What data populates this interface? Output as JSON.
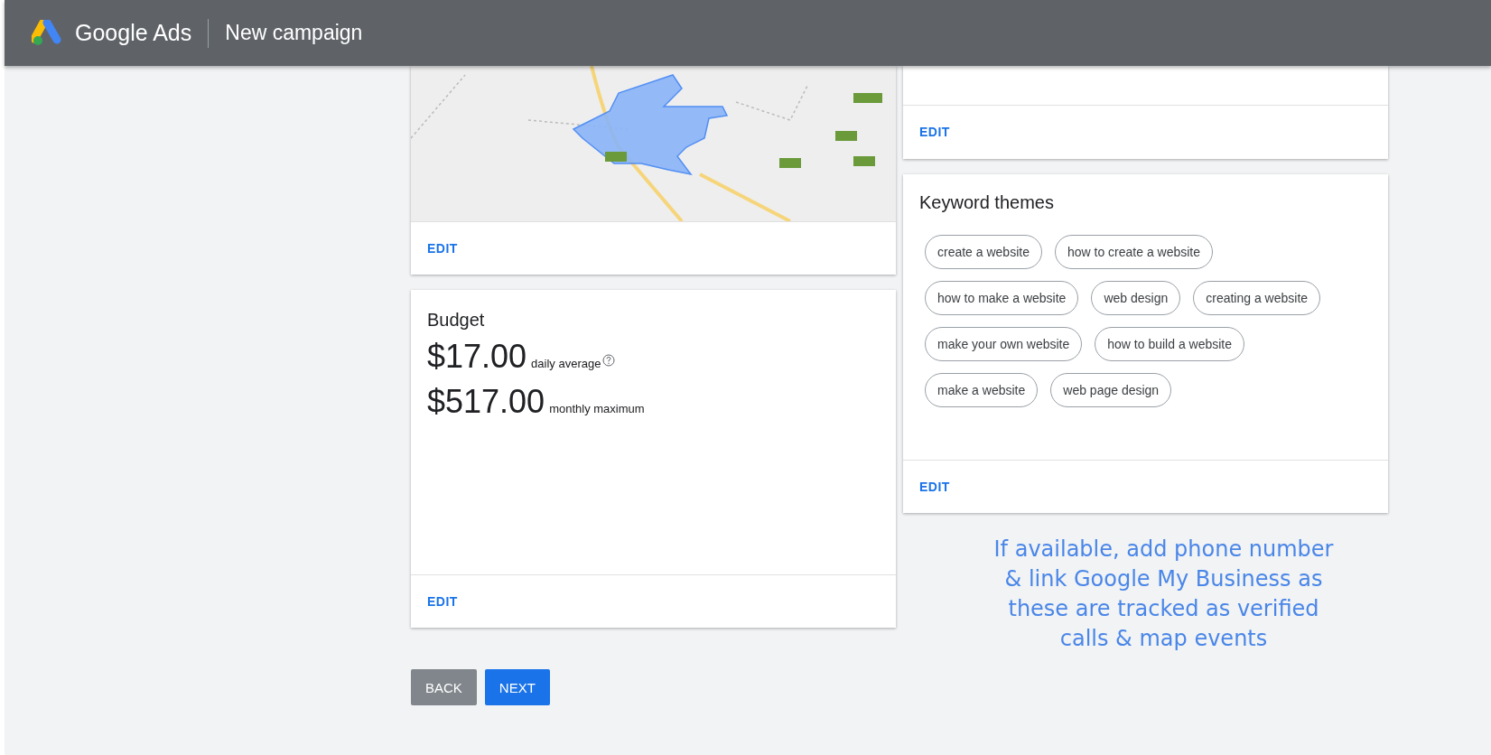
{
  "header": {
    "product": "Google Ads",
    "page_title": "New campaign"
  },
  "location_card": {
    "edit": "EDIT"
  },
  "top_right_card": {
    "edit": "EDIT"
  },
  "budget_card": {
    "title": "Budget",
    "lines": [
      {
        "amount": "$17.00",
        "caption": "daily average",
        "help": true
      },
      {
        "amount": "$517.00",
        "caption": "monthly maximum",
        "help": false
      }
    ],
    "edit": "EDIT"
  },
  "keyword_card": {
    "title": "Keyword themes",
    "keyword_rows": [
      [
        "create a website",
        "how to create a website"
      ],
      [
        "how to make a website",
        "web design",
        "creating a website"
      ],
      [
        "make your own website",
        "how to build a website"
      ],
      [
        "make a website",
        "web page design"
      ]
    ],
    "edit": "EDIT"
  },
  "buttons": [
    {
      "label": "BACK",
      "kind": "secondary"
    },
    {
      "label": "NEXT",
      "kind": "primary"
    }
  ],
  "annotation": "If available, add phone number & link Google My Business as these are tracked as verified calls & map events"
}
